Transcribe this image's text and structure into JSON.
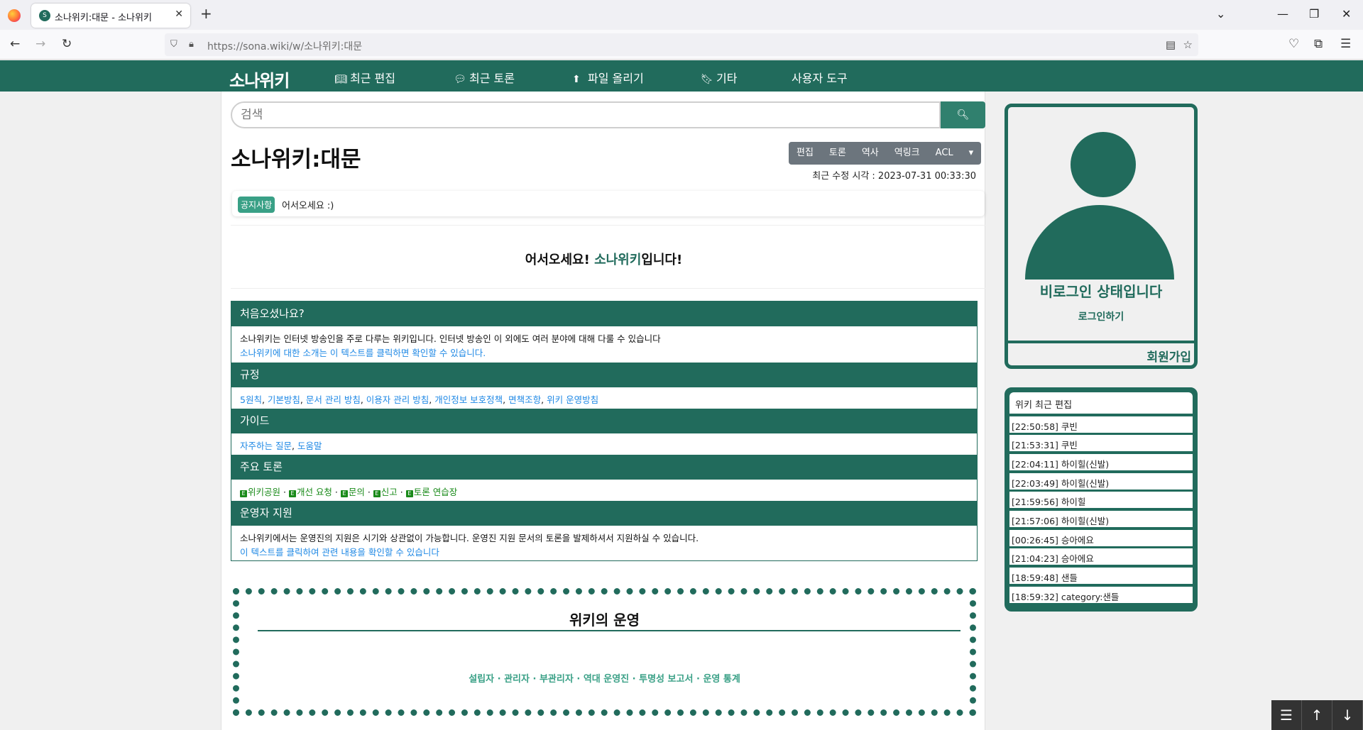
{
  "browser": {
    "tab_title": "소나위키:대문 - 소나위키",
    "url": "https://sona.wiki/w/소나위키:대문"
  },
  "site": {
    "logo": "소나위키",
    "menu": [
      {
        "icon": "book-open-icon",
        "label": "최근 편집"
      },
      {
        "icon": "comments-icon",
        "label": "최근 토론"
      },
      {
        "icon": "upload-icon",
        "label": "파일 올리기"
      },
      {
        "icon": "bookmark-icon",
        "label": "기타"
      },
      {
        "icon": "",
        "label": "사용자 도구"
      }
    ]
  },
  "search": {
    "placeholder": "검색"
  },
  "page": {
    "title": "소나위키:대문",
    "actions": [
      "편집",
      "토론",
      "역사",
      "역링크",
      "ACL"
    ],
    "last_modified": "최근 수정 시각 : 2023-07-31 00:33:30",
    "notice_badge": "공지사항",
    "notice_text": "어서오세요 :)",
    "welcome_prefix": "어서오세요! ",
    "welcome_highlight": "소나위키",
    "welcome_suffix": "입니다!"
  },
  "sections": {
    "intro": {
      "heading": "처음오셨나요?",
      "text": "소나위키는 인터넷 방송인을 주로 다루는 위키입니다. 인터넷 방송인 이 외에도 여러 분야에 대해 다룰 수 있습니다",
      "link": "소나위키에 대한 소개는 이 텍스트를 클릭하면 확인할 수 있습니다."
    },
    "rules": {
      "heading": "규정",
      "links": [
        "5원칙",
        "기본방침",
        "문서 관리 방침",
        "이용자 관리 방침",
        "개인정보 보호정책",
        "면책조항",
        "위키 운영방침"
      ]
    },
    "guide": {
      "heading": "가이드",
      "links": [
        "자주하는 질문",
        "도움말"
      ]
    },
    "discussions": {
      "heading": "주요 토론",
      "links": [
        "위키공원",
        "개선 요청",
        "문의",
        "신고",
        "토론 연습장"
      ]
    },
    "admin": {
      "heading": "운영자 지원",
      "text": "소나위키에서는 운영진의 지원은 시기와 상관없이 가능합니다. 운영진 지원 문서의 토론을 발제하셔서 지원하실 수 있습니다.",
      "link": "이 텍스트를 클릭하여 관련 내용을 확인할 수 있습니다"
    }
  },
  "operations": {
    "title": "위키의 운영",
    "links": [
      "설립자",
      "관리자",
      "부관리자",
      "역대 운영진",
      "투명성 보고서",
      "운영 통계"
    ]
  },
  "sidebar": {
    "login_status": "비로그인 상태입니다",
    "login_link": "로그인하기",
    "signup": "회원가입",
    "recent_title": "위키 최근 편집",
    "recent": [
      "[22:50:58] 쿠빈",
      "[21:53:31] 쿠빈",
      "[22:04:11] 하이힐(신발)",
      "[22:03:49] 하이힐(신발)",
      "[21:59:56] 하이힐",
      "[21:57:06] 하이힐(신발)",
      "[00:26:45] 승아에요",
      "[21:04:23] 승아에요",
      "[18:59:48] 샌들",
      "[18:59:32] category:샌들"
    ]
  },
  "colors": {
    "brand": "#216b5c",
    "accent": "#39a086",
    "link": "#1e88e5"
  }
}
